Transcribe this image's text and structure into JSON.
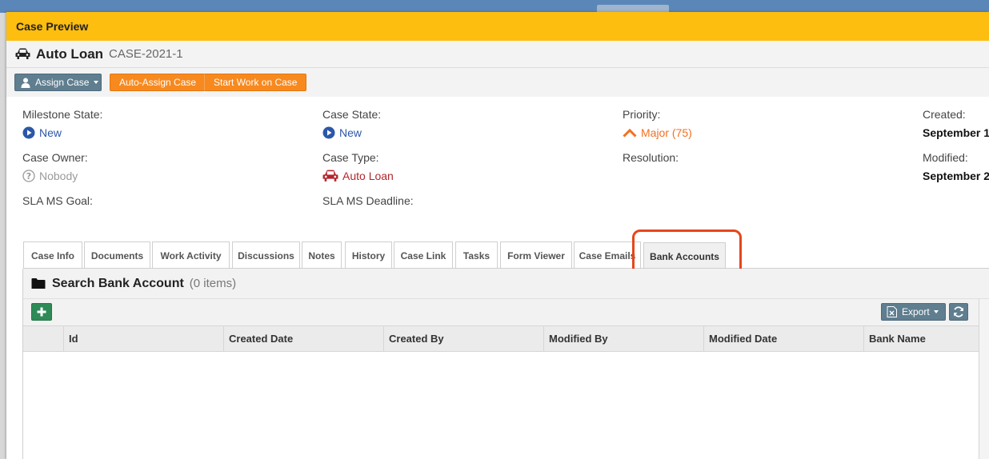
{
  "modal": {
    "title": "Case Preview"
  },
  "case": {
    "name": "Auto Loan",
    "id": "CASE-2021-1"
  },
  "actions": {
    "assign_label": "Assign Case",
    "auto_assign_label": "Auto-Assign Case",
    "start_work_label": "Start Work on Case"
  },
  "fields": {
    "milestone_state": {
      "label": "Milestone State:",
      "value": "New"
    },
    "case_state": {
      "label": "Case State:",
      "value": "New"
    },
    "priority": {
      "label": "Priority:",
      "value": "Major (75)"
    },
    "created": {
      "label": "Created:",
      "value": "September 1"
    },
    "case_owner": {
      "label": "Case Owner:",
      "value": "Nobody"
    },
    "case_type": {
      "label": "Case Type:",
      "value": "Auto Loan"
    },
    "resolution": {
      "label": "Resolution:"
    },
    "modified": {
      "label": "Modified:",
      "value": "September 2"
    },
    "sla_ms_goal": {
      "label": "SLA MS Goal:"
    },
    "sla_ms_deadline": {
      "label": "SLA MS Deadline:"
    }
  },
  "tabs": [
    {
      "label": "Case Info"
    },
    {
      "label": "Documents"
    },
    {
      "label": "Work Activity"
    },
    {
      "label": "Discussions"
    },
    {
      "label": "Notes"
    },
    {
      "label": "History"
    },
    {
      "label": "Case Link"
    },
    {
      "label": "Tasks"
    },
    {
      "label": "Form Viewer"
    },
    {
      "label": "Case Emails"
    },
    {
      "label": "Bank Accounts",
      "active": true
    }
  ],
  "panel": {
    "title": "Search Bank Account",
    "count": "(0 items)",
    "export_label": "Export"
  },
  "grid": {
    "columns": [
      "Id",
      "Created Date",
      "Created By",
      "Modified By",
      "Modified Date",
      "Bank Name"
    ]
  },
  "colors": {
    "header": "#fdbe10",
    "orange_button": "#f7891f",
    "slate_button": "#5f7e8f",
    "link_blue": "#2b57a8",
    "priority_orange": "#f37021",
    "highlight": "#e5461c"
  },
  "icons": [
    "car-icon",
    "user-icon",
    "play-circle-icon",
    "chevron-up-icon",
    "question-circle-icon",
    "folder-icon",
    "plus-icon",
    "excel-icon",
    "refresh-icon"
  ]
}
